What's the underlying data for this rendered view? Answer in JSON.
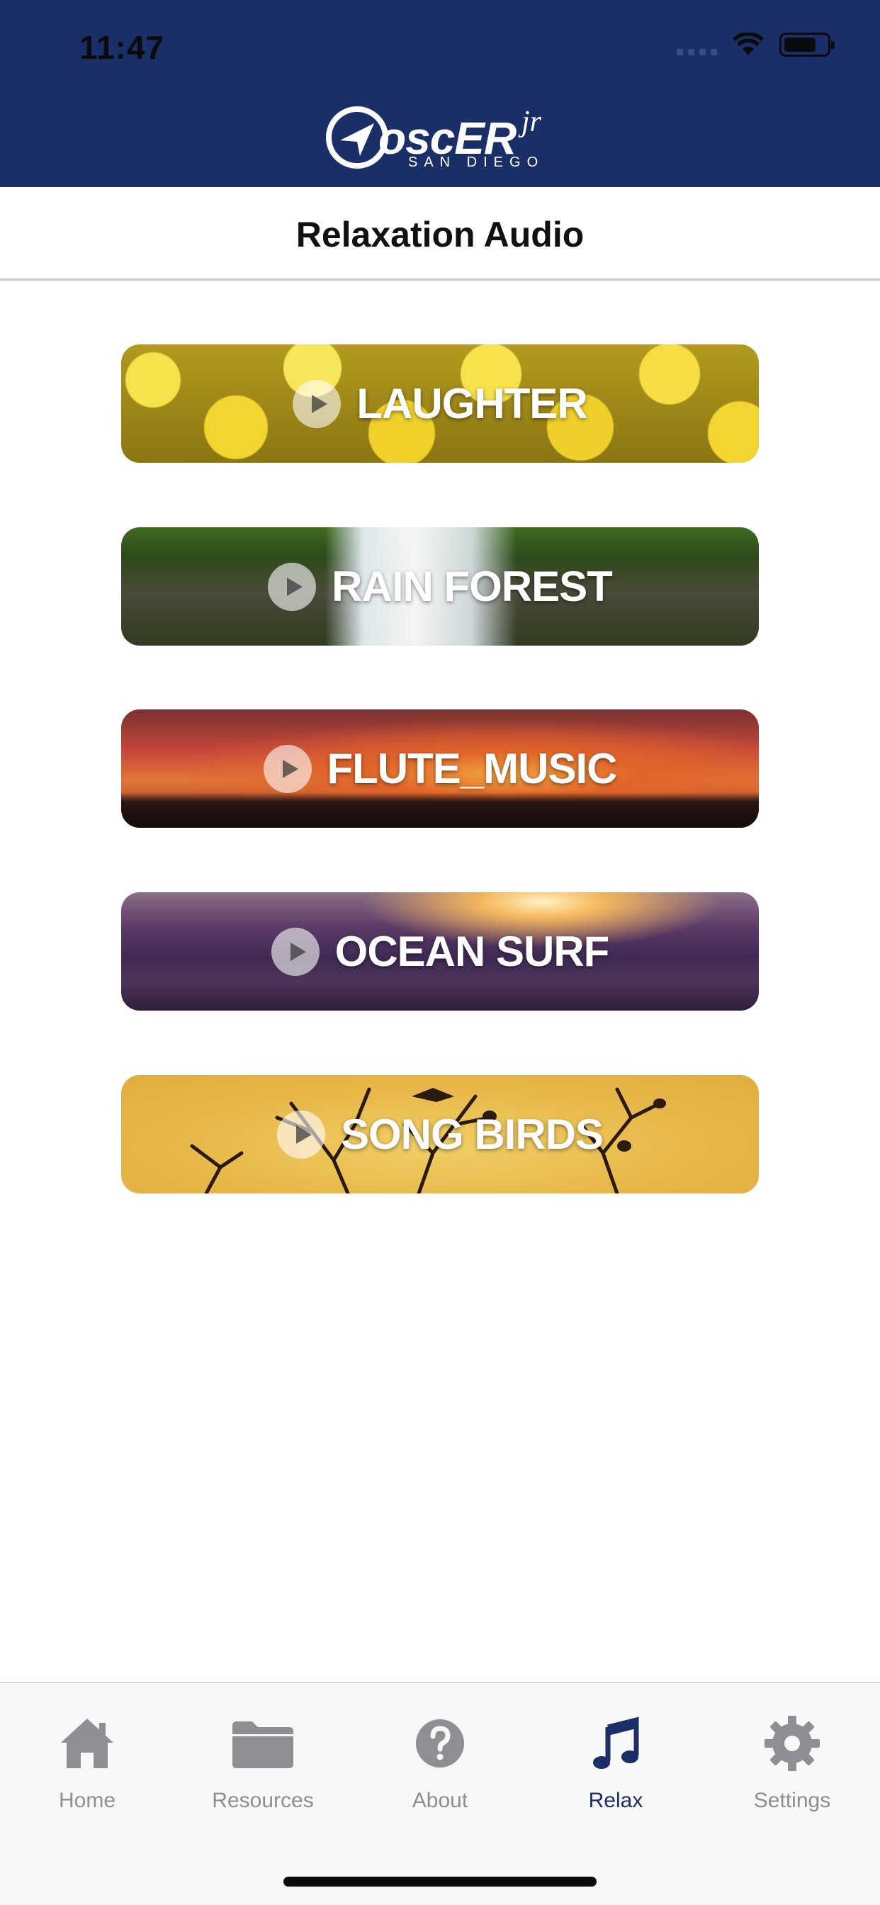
{
  "status_bar": {
    "time": "11:47"
  },
  "header": {
    "logo_text": "oscER",
    "logo_superscript": "jr",
    "logo_subtitle": "SAN DIEGO",
    "background": "#1a2e68"
  },
  "page": {
    "title": "Relaxation Audio"
  },
  "audio_items": [
    {
      "label": "LAUGHTER"
    },
    {
      "label": "RAIN FOREST"
    },
    {
      "label": "FLUTE_MUSIC"
    },
    {
      "label": "OCEAN SURF"
    },
    {
      "label": "SONG BIRDS"
    }
  ],
  "tabbar": {
    "active_color": "#1a2e68",
    "inactive_color": "#8e8e93",
    "tabs": [
      {
        "label": "Home",
        "icon": "home-icon",
        "active": false
      },
      {
        "label": "Resources",
        "icon": "folder-icon",
        "active": false
      },
      {
        "label": "About",
        "icon": "question-icon",
        "active": false
      },
      {
        "label": "Relax",
        "icon": "music-note-icon",
        "active": true
      },
      {
        "label": "Settings",
        "icon": "gear-icon",
        "active": false
      }
    ]
  }
}
